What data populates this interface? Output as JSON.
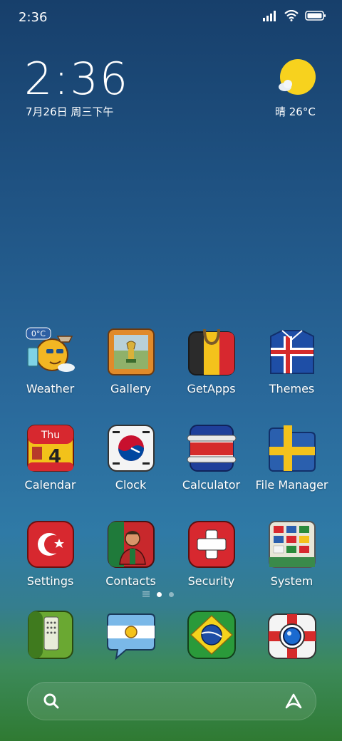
{
  "status_bar": {
    "time": "2:36"
  },
  "lock_widget": {
    "time": "2:36",
    "date": "7月26日 周三下午",
    "weather": "晴 26°C"
  },
  "apps": [
    {
      "label": "Weather",
      "icon": "weather-icon",
      "badge": "0°C"
    },
    {
      "label": "Gallery",
      "icon": "gallery-icon"
    },
    {
      "label": "GetApps",
      "icon": "getapps-icon"
    },
    {
      "label": "Themes",
      "icon": "themes-icon"
    },
    {
      "label": "Calendar",
      "icon": "calendar-icon",
      "day_name": "Thu",
      "day_num": "4"
    },
    {
      "label": "Clock",
      "icon": "clock-icon"
    },
    {
      "label": "Calculator",
      "icon": "calculator-icon"
    },
    {
      "label": "File Manager",
      "icon": "file-manager-icon"
    },
    {
      "label": "Settings",
      "icon": "settings-icon"
    },
    {
      "label": "Contacts",
      "icon": "contacts-icon"
    },
    {
      "label": "Security",
      "icon": "security-icon"
    },
    {
      "label": "System",
      "icon": "system-icon"
    }
  ],
  "dock": [
    {
      "icon": "phone-icon"
    },
    {
      "icon": "messages-icon"
    },
    {
      "icon": "browser-icon"
    },
    {
      "icon": "camera-icon"
    }
  ],
  "pages": {
    "count": 2,
    "current": 1
  }
}
